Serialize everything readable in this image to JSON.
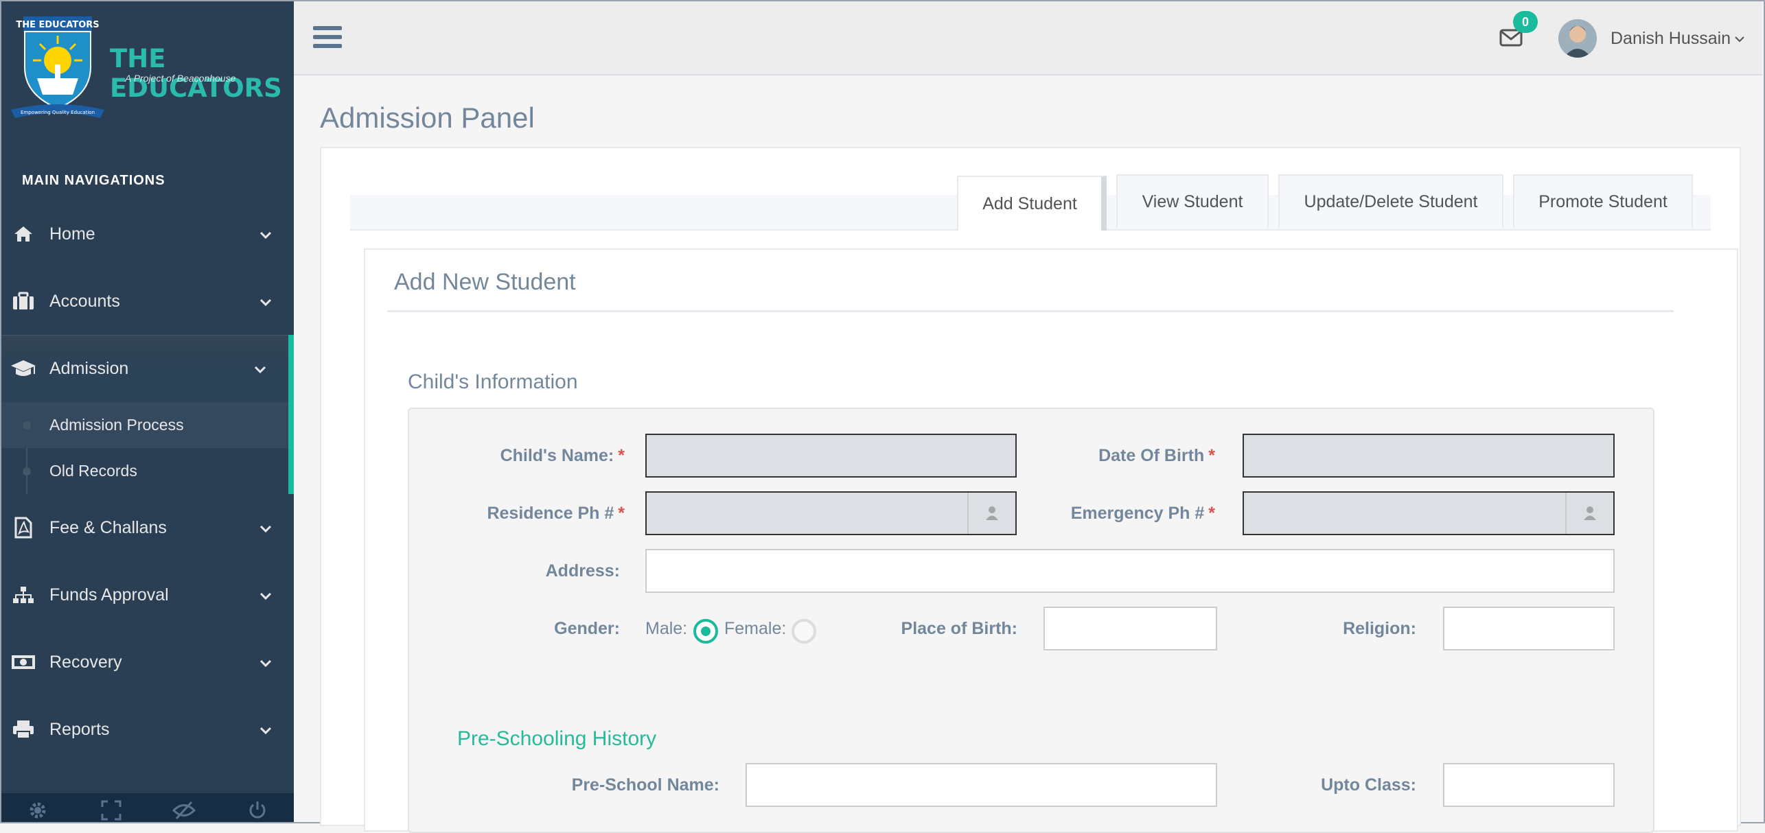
{
  "sidebar": {
    "brand": {
      "name": "THE EDUCATORS",
      "tagline": "A Project of Beaconhouse",
      "logo_text": "THE EDUCATORS",
      "logo_ribbon": "Empowering Quality Education"
    },
    "heading": "MAIN NAVIGATIONS",
    "items": [
      {
        "label": "Home",
        "icon": "home-icon"
      },
      {
        "label": "Accounts",
        "icon": "briefcase-icon"
      },
      {
        "label": "Admission",
        "icon": "graduation-cap-icon"
      },
      {
        "label": "Fee & Challans",
        "icon": "pdf-file-icon"
      },
      {
        "label": "Funds Approval",
        "icon": "sitemap-icon"
      },
      {
        "label": "Recovery",
        "icon": "money-icon"
      },
      {
        "label": "Reports",
        "icon": "print-icon"
      }
    ],
    "submenu": [
      {
        "label": "Admission Process"
      },
      {
        "label": "Old Records"
      }
    ],
    "footer_icons": [
      "settings-icon",
      "fullscreen-icon",
      "hide-eye-icon",
      "power-icon"
    ]
  },
  "topbar": {
    "mail_count": "0",
    "user_name": "Danish Hussain"
  },
  "page": {
    "title": "Admission Panel"
  },
  "tabs": [
    {
      "label": "Add Student"
    },
    {
      "label": "View Student"
    },
    {
      "label": "Update/Delete Student"
    },
    {
      "label": "Promote Student"
    }
  ],
  "form": {
    "title": "Add New Student",
    "child_info_title": "Child's Information",
    "fields": {
      "child_name": {
        "label": "Child's Name:",
        "value": ""
      },
      "dob": {
        "label": "Date Of Birth",
        "value": ""
      },
      "residence_ph": {
        "label": "Residence Ph #",
        "value": ""
      },
      "emergency_ph": {
        "label": "Emergency Ph #",
        "value": ""
      },
      "address": {
        "label": "Address:",
        "value": ""
      },
      "gender": {
        "label": "Gender:",
        "male": "Male:",
        "female": "Female:",
        "selected": "Male"
      },
      "place_of_birth": {
        "label": "Place of Birth:",
        "value": ""
      },
      "religion": {
        "label": "Religion:",
        "value": ""
      }
    },
    "required_mark": "*",
    "preschool_title": "Pre-Schooling History",
    "preschool_name": {
      "label": "Pre-School Name:",
      "value": ""
    },
    "upto_class": {
      "label": "Upto Class:",
      "value": ""
    }
  },
  "colors": {
    "sidebar": "#2a3f54",
    "accent": "#1abb9c",
    "title": "#73879c",
    "green_heading": "#26b99a"
  }
}
